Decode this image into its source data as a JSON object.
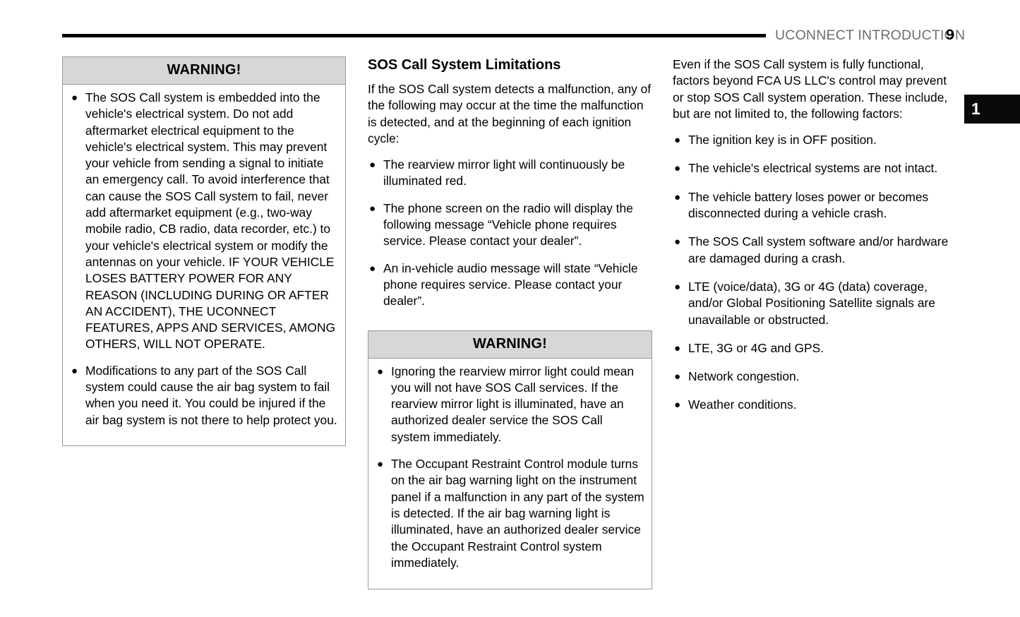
{
  "header": {
    "title": "UCONNECT INTRODUCTION",
    "page_number": "9",
    "chapter_tab": "1"
  },
  "columns": {
    "col1": {
      "warning_box": {
        "title": "WARNING!",
        "bullets": [
          "The SOS Call system is embedded into the vehicle's electrical system. Do not add aftermarket electrical equipment to the vehicle's electrical system. This may prevent your vehicle from sending a signal to initiate an emergency call. To avoid interference that can cause the SOS Call system to fail, never add aftermarket equipment (e.g., two-way mobile radio, CB radio, data recorder, etc.) to your vehicle's electrical system or modify the antennas on your vehicle. IF YOUR VEHICLE LOSES BATTERY POWER FOR ANY REASON (INCLUDING DURING OR AFTER AN ACCIDENT), THE UCONNECT FEATURES, APPS AND SERVICES, AMONG OTHERS, WILL NOT OPERATE.",
          "Modifications to any part of the SOS Call system could cause the air bag system to fail when you need it. You could be injured if the air bag system is not there to help protect you."
        ]
      }
    },
    "col2": {
      "heading": "SOS Call System Limitations",
      "intro": "If the SOS Call system detects a malfunction, any of the following may occur at the time the malfunction is detected, and at the beginning of each ignition cycle:",
      "bullets": [
        "The rearview mirror light will continuously be illuminated red.",
        "The phone screen on the radio will display the following message “Vehicle phone requires service. Please contact your dealer”.",
        "An in-vehicle audio message will state “Vehicle phone requires service. Please contact your dealer”."
      ],
      "warning_box": {
        "title": "WARNING!",
        "bullets": [
          "Ignoring the rearview mirror light could mean you will not have SOS Call services. If the rearview mirror light is illuminated, have an authorized dealer service the SOS Call system immediately.",
          "The Occupant Restraint Control module turns on the air bag warning light on the instrument panel if a malfunction in any part of the system is detected. If the air bag warning light is illuminated, have an authorized dealer service the Occupant Restraint Control system immediately."
        ]
      }
    },
    "col3": {
      "intro": "Even if the SOS Call system is fully functional, factors beyond FCA US LLC's control may prevent or stop SOS Call system operation. These include, but are not limited to, the following factors:",
      "bullets": [
        "The ignition key is in OFF position.",
        "The vehicle's electrical systems are not intact.",
        "The vehicle battery loses power or becomes disconnected during a vehicle crash.",
        "The SOS Call system software and/or hardware are damaged during a crash.",
        "LTE (voice/data), 3G or 4G (data) coverage, and/or Global Positioning Satellite signals are unavailable or obstructed.",
        "LTE, 3G or 4G and GPS.",
        "Network congestion.",
        "Weather conditions."
      ]
    }
  },
  "icons": {
    "bullet": "●"
  },
  "colors": {
    "rule": "#000000",
    "header_title": "#6e6e6e",
    "warning_header_bg": "#d7d7d7",
    "warning_border": "#9a9a9a",
    "chapter_tab_bg": "#0a0a0a"
  }
}
